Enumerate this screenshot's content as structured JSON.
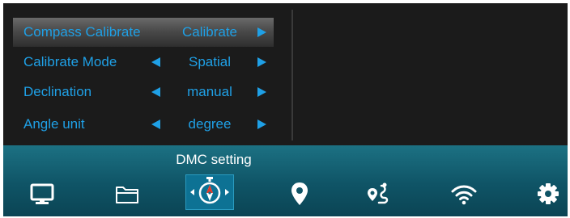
{
  "menu": {
    "items": [
      {
        "label": "Compass Calibrate",
        "value": "Calibrate",
        "selected": true,
        "has_left_arrow": false
      },
      {
        "label": "Calibrate Mode",
        "value": "Spatial",
        "selected": false,
        "has_left_arrow": true
      },
      {
        "label": "Declination",
        "value": "manual",
        "selected": false,
        "has_left_arrow": true
      },
      {
        "label": "Angle unit",
        "value": "degree",
        "selected": false,
        "has_left_arrow": true
      }
    ]
  },
  "bottom_bar": {
    "title": "DMC setting",
    "icons": [
      {
        "name": "monitor-icon",
        "active": false
      },
      {
        "name": "folder-icon",
        "active": false
      },
      {
        "name": "compass-icon",
        "active": true
      },
      {
        "name": "location-pin-icon",
        "active": false
      },
      {
        "name": "route-icon",
        "active": false
      },
      {
        "name": "wifi-icon",
        "active": false
      },
      {
        "name": "gear-icon",
        "active": false
      }
    ]
  },
  "colors": {
    "accent": "#1fa0e6",
    "background": "#1b1b1b",
    "bar_background": "#0f5466",
    "active_tab": "#0d7294",
    "compass_needle": "#e03a2a"
  }
}
